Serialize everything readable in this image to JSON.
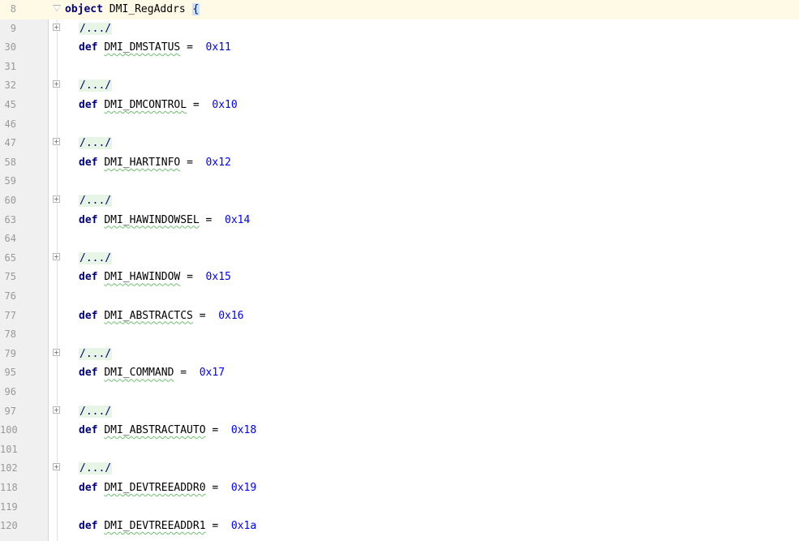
{
  "object_keyword": "object",
  "object_name": "DMI_RegAddrs",
  "open_brace": "{",
  "def_keyword": "def",
  "equals": "=",
  "folded_text": "/.../",
  "lines": [
    {
      "num": "8",
      "kind": "object"
    },
    {
      "num": "9",
      "kind": "folded"
    },
    {
      "num": "30",
      "kind": "def",
      "name": "DMI_DMSTATUS",
      "value": "0x11"
    },
    {
      "num": "31",
      "kind": "blank"
    },
    {
      "num": "32",
      "kind": "folded"
    },
    {
      "num": "45",
      "kind": "def",
      "name": "DMI_DMCONTROL",
      "value": "0x10"
    },
    {
      "num": "46",
      "kind": "blank"
    },
    {
      "num": "47",
      "kind": "folded"
    },
    {
      "num": "58",
      "kind": "def",
      "name": "DMI_HARTINFO",
      "value": "0x12"
    },
    {
      "num": "59",
      "kind": "blank"
    },
    {
      "num": "60",
      "kind": "folded"
    },
    {
      "num": "63",
      "kind": "def",
      "name": "DMI_HAWINDOWSEL",
      "value": "0x14"
    },
    {
      "num": "64",
      "kind": "blank"
    },
    {
      "num": "65",
      "kind": "folded"
    },
    {
      "num": "75",
      "kind": "def",
      "name": "DMI_HAWINDOW",
      "value": "0x15"
    },
    {
      "num": "76",
      "kind": "blank"
    },
    {
      "num": "77",
      "kind": "def",
      "name": "DMI_ABSTRACTCS",
      "value": "0x16"
    },
    {
      "num": "78",
      "kind": "blank"
    },
    {
      "num": "79",
      "kind": "folded"
    },
    {
      "num": "95",
      "kind": "def",
      "name": "DMI_COMMAND",
      "value": "0x17"
    },
    {
      "num": "96",
      "kind": "blank"
    },
    {
      "num": "97",
      "kind": "folded"
    },
    {
      "num": "100",
      "kind": "def",
      "name": "DMI_ABSTRACTAUTO",
      "value": "0x18"
    },
    {
      "num": "101",
      "kind": "blank"
    },
    {
      "num": "102",
      "kind": "folded"
    },
    {
      "num": "118",
      "kind": "def",
      "name": "DMI_DEVTREEADDR0",
      "value": "0x19"
    },
    {
      "num": "119",
      "kind": "blank"
    },
    {
      "num": "120",
      "kind": "def",
      "name": "DMI_DEVTREEADDR1",
      "value": "0x1a"
    }
  ]
}
